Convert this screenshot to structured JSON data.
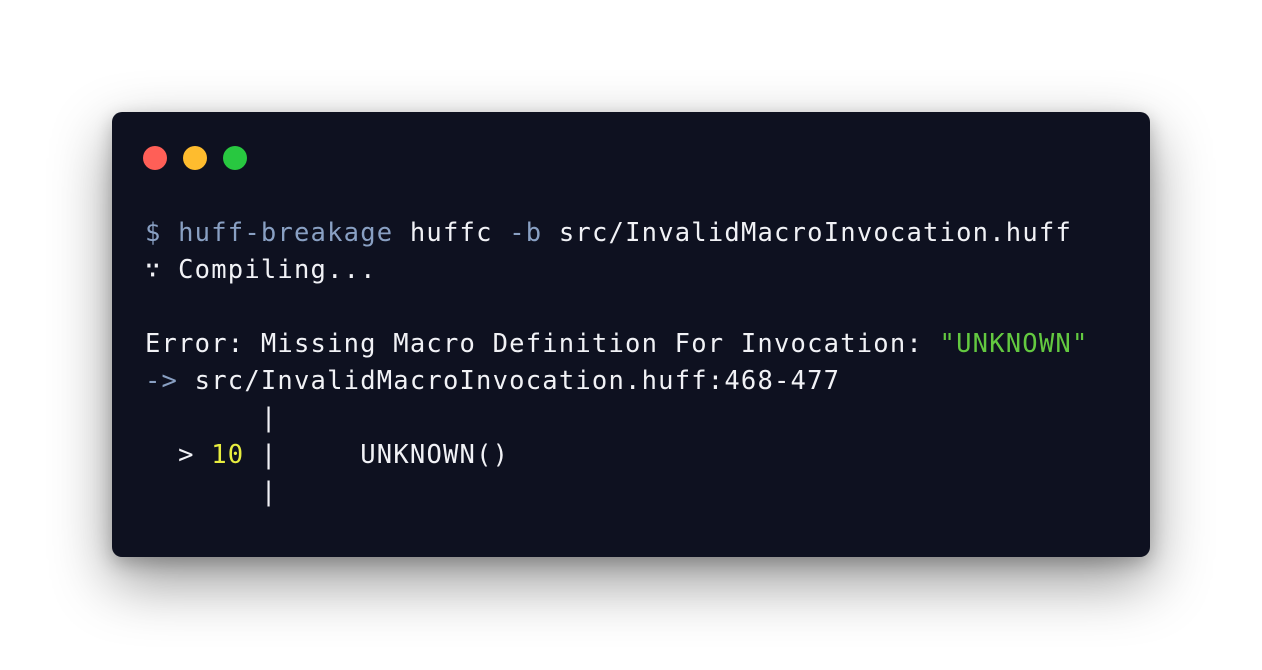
{
  "window": {
    "controls": [
      {
        "name": "close",
        "color": "#ff5f57"
      },
      {
        "name": "minimize",
        "color": "#febc2e"
      },
      {
        "name": "maximize",
        "color": "#28c840"
      }
    ]
  },
  "terminal": {
    "command": {
      "prompt": "$",
      "directory": "huff-breakage",
      "program": "huffc",
      "flag": "-b",
      "argument": "src/InvalidMacroInvocation.huff"
    },
    "status": "∵ Compiling...",
    "error": {
      "message": "Error: Missing Macro Definition For Invocation:",
      "name": "\"UNKNOWN\"",
      "arrow": "->",
      "location": "src/InvalidMacroInvocation.huff:468-477"
    },
    "snippet": {
      "gutter_top": "       |",
      "marker": "  >",
      "line_number": "10",
      "separator": "|",
      "code": "     UNKNOWN()",
      "gutter_bottom": "       |"
    }
  },
  "colors": {
    "background": "#0e1120",
    "text": "#f1f2f6",
    "muted": "#89a0c3",
    "string": "#63c940",
    "line_number": "#e7ed3f"
  }
}
